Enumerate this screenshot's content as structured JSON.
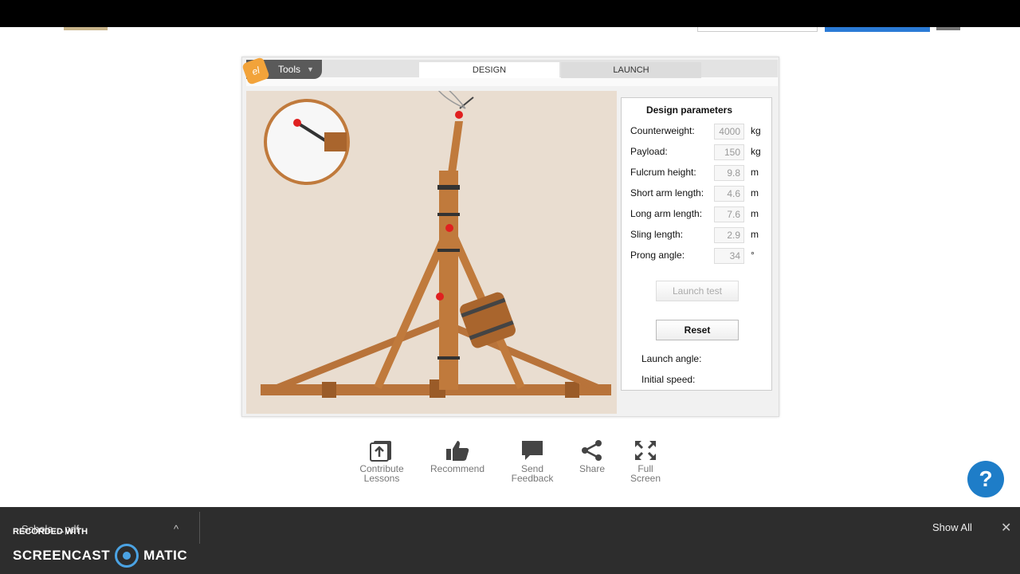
{
  "tools_label": "Tools",
  "tabs": {
    "design": "DESIGN",
    "launch": "LAUNCH"
  },
  "panel": {
    "title": "Design parameters",
    "params": [
      {
        "label": "Counterweight:",
        "value": "4000",
        "unit": "kg"
      },
      {
        "label": "Payload:",
        "value": "150",
        "unit": "kg"
      },
      {
        "label": "Fulcrum height:",
        "value": "9.8",
        "unit": "m"
      },
      {
        "label": "Short arm length:",
        "value": "4.6",
        "unit": "m"
      },
      {
        "label": "Long arm length:",
        "value": "7.6",
        "unit": "m"
      },
      {
        "label": "Sling length:",
        "value": "2.9",
        "unit": "m"
      },
      {
        "label": "Prong angle:",
        "value": "34",
        "unit": "°"
      }
    ],
    "launch_test": "Launch test",
    "reset": "Reset",
    "launch_angle": "Launch angle:",
    "initial_speed": "Initial speed:"
  },
  "actions": [
    {
      "line1": "Contribute",
      "line2": "Lessons"
    },
    {
      "line1": "Recommend",
      "line2": ""
    },
    {
      "line1": "Send",
      "line2": "Feedback"
    },
    {
      "line1": "Share",
      "line2": ""
    },
    {
      "line1": "Full",
      "line2": "Screen"
    }
  ],
  "help": "?",
  "download": {
    "file": "...Schola....pdf",
    "show_all": "Show All"
  },
  "watermark": {
    "line1": "RECORDED WITH",
    "line2a": "SCREENCAST",
    "line2b": "MATIC"
  },
  "colors": {
    "accent": "#1e7dc8",
    "wood": "#c07a3c",
    "marker": "#e02020"
  }
}
